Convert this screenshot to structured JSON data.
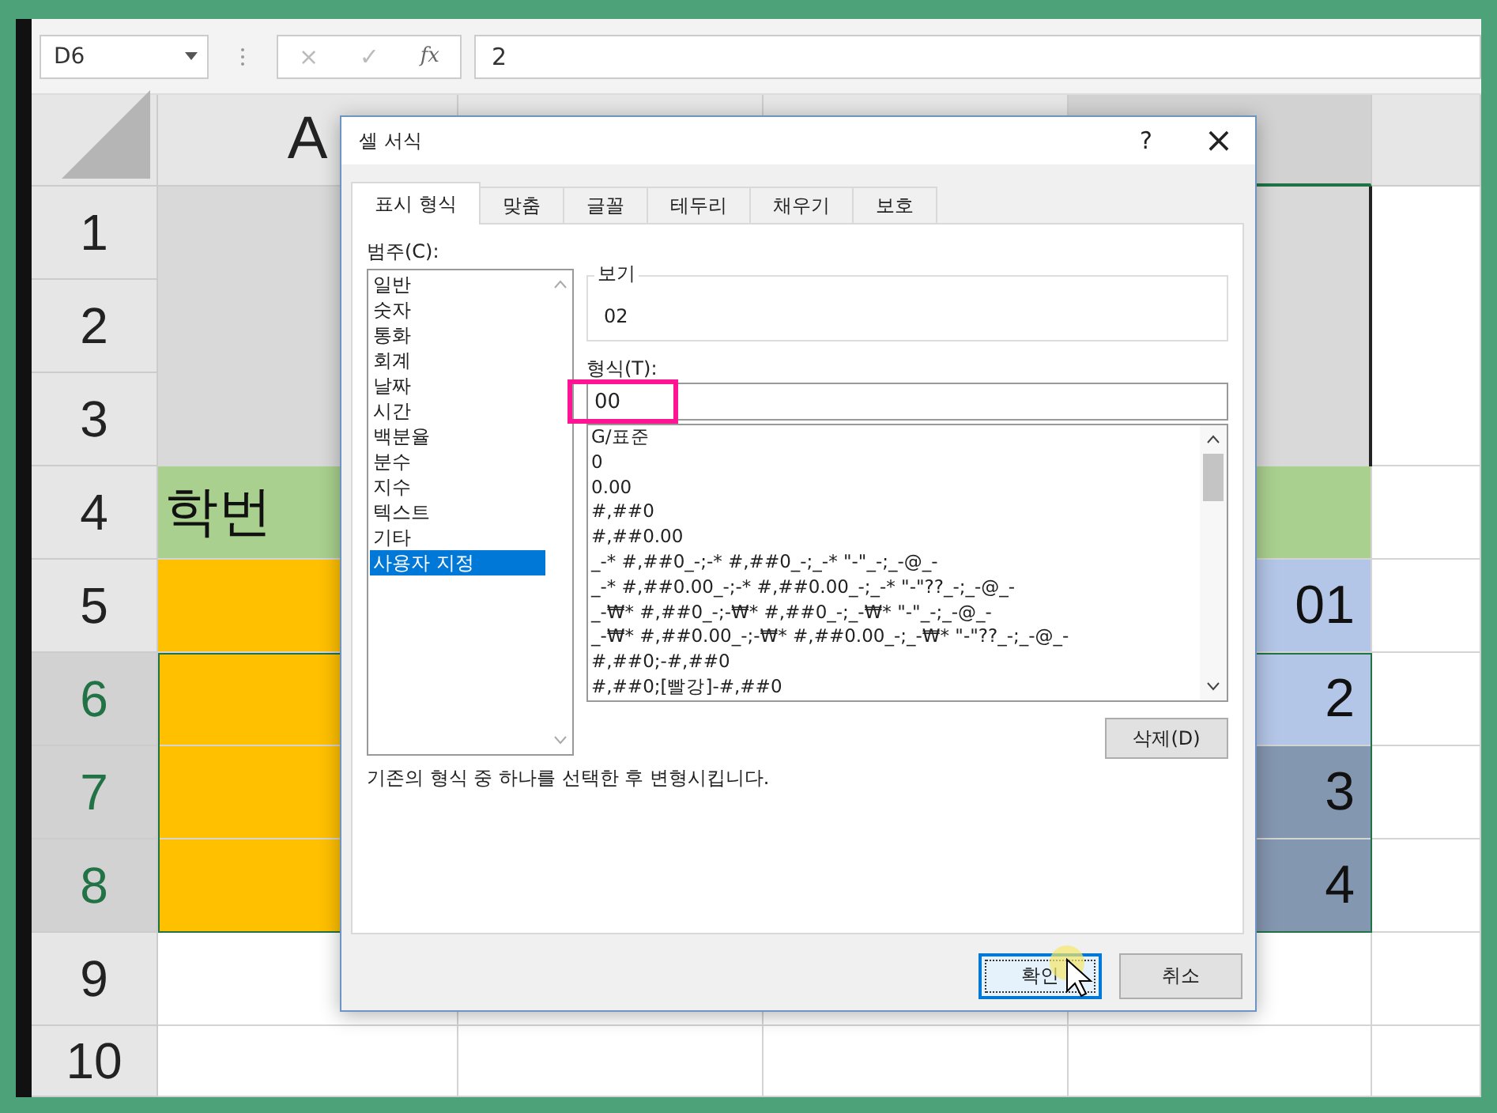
{
  "sheet": {
    "name_box": "D6",
    "formula_icons": [
      "×",
      "✓",
      "fx"
    ],
    "formula": "2",
    "columns": [
      {
        "label": "A",
        "selected": false
      },
      {
        "selected": false
      },
      {
        "selected": false
      },
      {
        "selected": true
      },
      {
        "selected": false
      }
    ],
    "title_cell": {
      "color": "#d9d9d9"
    },
    "row_headers": [
      {
        "label": "1",
        "selected": false
      },
      {
        "label": "2",
        "selected": false
      },
      {
        "label": "3",
        "selected": false
      },
      {
        "label": "4",
        "selected": false
      },
      {
        "label": "5",
        "selected": false
      },
      {
        "label": "6",
        "selected": true
      },
      {
        "label": "7",
        "selected": true
      },
      {
        "label": "8",
        "selected": true
      },
      {
        "label": "9",
        "selected": false
      },
      {
        "label": "10",
        "selected": false
      }
    ],
    "rows": [
      {
        "cells": [
          {
            "text": "학번",
            "color": "#a9d08e"
          },
          {},
          {},
          {
            "color": "#a9d08e"
          },
          {}
        ]
      },
      {
        "cells": [
          {
            "color": "#ffc000"
          },
          {},
          {},
          {
            "text": "01",
            "color": "#b4c6e7"
          },
          {}
        ]
      },
      {
        "cells": [
          {
            "color": "#ffc000"
          },
          {},
          {},
          {
            "text": "2",
            "color": "#b4c6e7"
          },
          {}
        ]
      },
      {
        "cells": [
          {
            "color": "#ffc000"
          },
          {},
          {},
          {
            "text": "3",
            "color": "#8497b0"
          },
          {}
        ]
      },
      {
        "cells": [
          {
            "color": "#ffc000"
          },
          {},
          {},
          {
            "text": "4",
            "color": "#8497b0"
          },
          {}
        ]
      },
      {
        "cells": [
          {},
          {},
          {},
          {},
          {}
        ]
      },
      {
        "cells": [
          {},
          {},
          {},
          {},
          {}
        ]
      }
    ]
  },
  "dialog": {
    "title": "셀 서식",
    "help": "?",
    "close": "×",
    "tabs": [
      {
        "label": "표시 형식",
        "selected": true
      },
      {
        "label": "맞춤",
        "selected": false
      },
      {
        "label": "글꼴",
        "selected": false
      },
      {
        "label": "테두리",
        "selected": false
      },
      {
        "label": "채우기",
        "selected": false
      },
      {
        "label": "보호",
        "selected": false
      }
    ],
    "category_label": "범주(C):",
    "categories": [
      {
        "label": "일반",
        "selected": false
      },
      {
        "label": "숫자",
        "selected": false
      },
      {
        "label": "통화",
        "selected": false
      },
      {
        "label": "회계",
        "selected": false
      },
      {
        "label": "날짜",
        "selected": false
      },
      {
        "label": "시간",
        "selected": false
      },
      {
        "label": "백분율",
        "selected": false
      },
      {
        "label": "분수",
        "selected": false
      },
      {
        "label": "지수",
        "selected": false
      },
      {
        "label": "텍스트",
        "selected": false
      },
      {
        "label": "기타",
        "selected": false
      },
      {
        "label": "사용자 지정",
        "selected": true
      }
    ],
    "sample_label": "보기",
    "sample_value": "02",
    "format_label": "형식(T):",
    "format_value": "00",
    "formats": [
      "G/표준",
      "0",
      "0.00",
      "#,##0",
      "#,##0.00",
      "_-* #,##0_-;-* #,##0_-;_-* \"-\"_-;_-@_-",
      "_-* #,##0.00_-;-* #,##0.00_-;_-* \"-\"??_-;_-@_-",
      "_-₩* #,##0_-;-₩* #,##0_-;_-₩* \"-\"_-;_-@_-",
      "_-₩* #,##0.00_-;-₩* #,##0.00_-;_-₩* \"-\"??_-;_-@_-",
      "#,##0;-#,##0",
      "#,##0;[빨강]-#,##0"
    ],
    "delete_button": "삭제(D)",
    "description": "기존의 형식 중 하나를 선택한 후 변형시킵니다.",
    "ok_button": "확인",
    "cancel_button": "취소"
  }
}
